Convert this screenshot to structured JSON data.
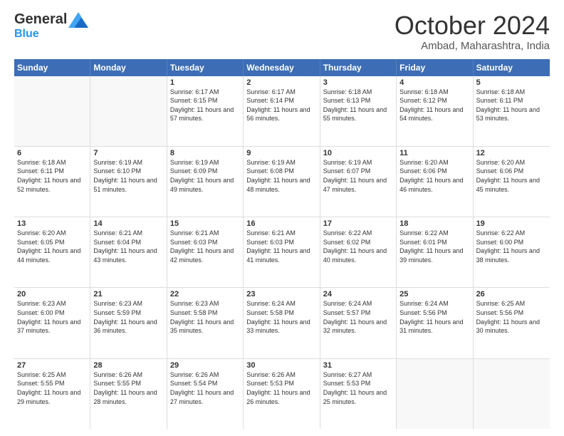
{
  "header": {
    "logo_general": "General",
    "logo_blue": "Blue",
    "month": "October 2024",
    "location": "Ambad, Maharashtra, India"
  },
  "days_of_week": [
    "Sunday",
    "Monday",
    "Tuesday",
    "Wednesday",
    "Thursday",
    "Friday",
    "Saturday"
  ],
  "weeks": [
    [
      {
        "day": "",
        "empty": true
      },
      {
        "day": "",
        "empty": true
      },
      {
        "day": "1",
        "sunrise": "Sunrise: 6:17 AM",
        "sunset": "Sunset: 6:15 PM",
        "daylight": "Daylight: 11 hours and 57 minutes."
      },
      {
        "day": "2",
        "sunrise": "Sunrise: 6:17 AM",
        "sunset": "Sunset: 6:14 PM",
        "daylight": "Daylight: 11 hours and 56 minutes."
      },
      {
        "day": "3",
        "sunrise": "Sunrise: 6:18 AM",
        "sunset": "Sunset: 6:13 PM",
        "daylight": "Daylight: 11 hours and 55 minutes."
      },
      {
        "day": "4",
        "sunrise": "Sunrise: 6:18 AM",
        "sunset": "Sunset: 6:12 PM",
        "daylight": "Daylight: 11 hours and 54 minutes."
      },
      {
        "day": "5",
        "sunrise": "Sunrise: 6:18 AM",
        "sunset": "Sunset: 6:11 PM",
        "daylight": "Daylight: 11 hours and 53 minutes."
      }
    ],
    [
      {
        "day": "6",
        "sunrise": "Sunrise: 6:18 AM",
        "sunset": "Sunset: 6:11 PM",
        "daylight": "Daylight: 11 hours and 52 minutes."
      },
      {
        "day": "7",
        "sunrise": "Sunrise: 6:19 AM",
        "sunset": "Sunset: 6:10 PM",
        "daylight": "Daylight: 11 hours and 51 minutes."
      },
      {
        "day": "8",
        "sunrise": "Sunrise: 6:19 AM",
        "sunset": "Sunset: 6:09 PM",
        "daylight": "Daylight: 11 hours and 49 minutes."
      },
      {
        "day": "9",
        "sunrise": "Sunrise: 6:19 AM",
        "sunset": "Sunset: 6:08 PM",
        "daylight": "Daylight: 11 hours and 48 minutes."
      },
      {
        "day": "10",
        "sunrise": "Sunrise: 6:19 AM",
        "sunset": "Sunset: 6:07 PM",
        "daylight": "Daylight: 11 hours and 47 minutes."
      },
      {
        "day": "11",
        "sunrise": "Sunrise: 6:20 AM",
        "sunset": "Sunset: 6:06 PM",
        "daylight": "Daylight: 11 hours and 46 minutes."
      },
      {
        "day": "12",
        "sunrise": "Sunrise: 6:20 AM",
        "sunset": "Sunset: 6:06 PM",
        "daylight": "Daylight: 11 hours and 45 minutes."
      }
    ],
    [
      {
        "day": "13",
        "sunrise": "Sunrise: 6:20 AM",
        "sunset": "Sunset: 6:05 PM",
        "daylight": "Daylight: 11 hours and 44 minutes."
      },
      {
        "day": "14",
        "sunrise": "Sunrise: 6:21 AM",
        "sunset": "Sunset: 6:04 PM",
        "daylight": "Daylight: 11 hours and 43 minutes."
      },
      {
        "day": "15",
        "sunrise": "Sunrise: 6:21 AM",
        "sunset": "Sunset: 6:03 PM",
        "daylight": "Daylight: 11 hours and 42 minutes."
      },
      {
        "day": "16",
        "sunrise": "Sunrise: 6:21 AM",
        "sunset": "Sunset: 6:03 PM",
        "daylight": "Daylight: 11 hours and 41 minutes."
      },
      {
        "day": "17",
        "sunrise": "Sunrise: 6:22 AM",
        "sunset": "Sunset: 6:02 PM",
        "daylight": "Daylight: 11 hours and 40 minutes."
      },
      {
        "day": "18",
        "sunrise": "Sunrise: 6:22 AM",
        "sunset": "Sunset: 6:01 PM",
        "daylight": "Daylight: 11 hours and 39 minutes."
      },
      {
        "day": "19",
        "sunrise": "Sunrise: 6:22 AM",
        "sunset": "Sunset: 6:00 PM",
        "daylight": "Daylight: 11 hours and 38 minutes."
      }
    ],
    [
      {
        "day": "20",
        "sunrise": "Sunrise: 6:23 AM",
        "sunset": "Sunset: 6:00 PM",
        "daylight": "Daylight: 11 hours and 37 minutes."
      },
      {
        "day": "21",
        "sunrise": "Sunrise: 6:23 AM",
        "sunset": "Sunset: 5:59 PM",
        "daylight": "Daylight: 11 hours and 36 minutes."
      },
      {
        "day": "22",
        "sunrise": "Sunrise: 6:23 AM",
        "sunset": "Sunset: 5:58 PM",
        "daylight": "Daylight: 11 hours and 35 minutes."
      },
      {
        "day": "23",
        "sunrise": "Sunrise: 6:24 AM",
        "sunset": "Sunset: 5:58 PM",
        "daylight": "Daylight: 11 hours and 33 minutes."
      },
      {
        "day": "24",
        "sunrise": "Sunrise: 6:24 AM",
        "sunset": "Sunset: 5:57 PM",
        "daylight": "Daylight: 11 hours and 32 minutes."
      },
      {
        "day": "25",
        "sunrise": "Sunrise: 6:24 AM",
        "sunset": "Sunset: 5:56 PM",
        "daylight": "Daylight: 11 hours and 31 minutes."
      },
      {
        "day": "26",
        "sunrise": "Sunrise: 6:25 AM",
        "sunset": "Sunset: 5:56 PM",
        "daylight": "Daylight: 11 hours and 30 minutes."
      }
    ],
    [
      {
        "day": "27",
        "sunrise": "Sunrise: 6:25 AM",
        "sunset": "Sunset: 5:55 PM",
        "daylight": "Daylight: 11 hours and 29 minutes."
      },
      {
        "day": "28",
        "sunrise": "Sunrise: 6:26 AM",
        "sunset": "Sunset: 5:55 PM",
        "daylight": "Daylight: 11 hours and 28 minutes."
      },
      {
        "day": "29",
        "sunrise": "Sunrise: 6:26 AM",
        "sunset": "Sunset: 5:54 PM",
        "daylight": "Daylight: 11 hours and 27 minutes."
      },
      {
        "day": "30",
        "sunrise": "Sunrise: 6:26 AM",
        "sunset": "Sunset: 5:53 PM",
        "daylight": "Daylight: 11 hours and 26 minutes."
      },
      {
        "day": "31",
        "sunrise": "Sunrise: 6:27 AM",
        "sunset": "Sunset: 5:53 PM",
        "daylight": "Daylight: 11 hours and 25 minutes."
      },
      {
        "day": "",
        "empty": true
      },
      {
        "day": "",
        "empty": true
      }
    ]
  ]
}
